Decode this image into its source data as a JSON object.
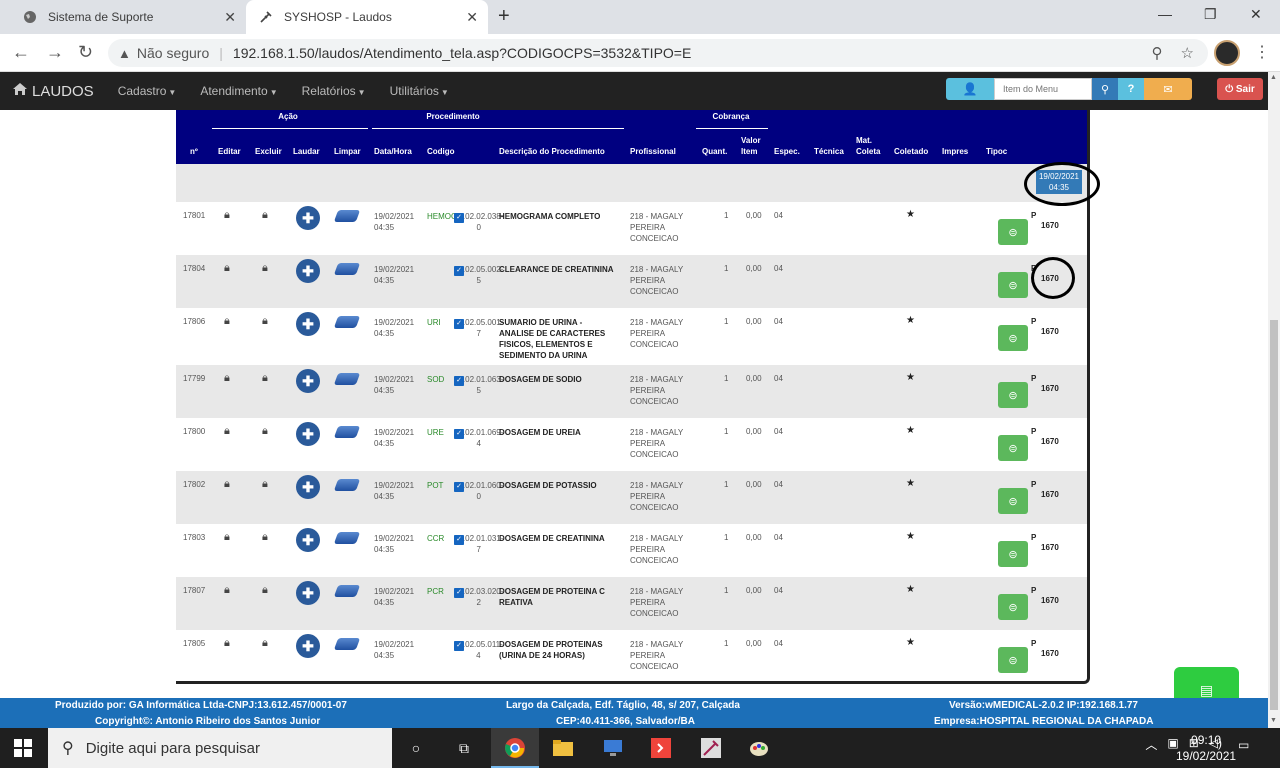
{
  "browser": {
    "tabs": [
      {
        "title": "Sistema de Suporte"
      },
      {
        "title": "SYSHOSP - Laudos"
      }
    ],
    "security_label": "Não seguro",
    "url": "192.168.1.50/laudos/Atendimento_tela.asp?CODIGOCPS=3532&TIPO=E"
  },
  "appnav": {
    "brand": "LAUDOS",
    "menus": [
      "Cadastro",
      "Atendimento",
      "Relatórios",
      "Utilitários"
    ],
    "search_placeholder": "Item do Menu",
    "logout_label": "Sair"
  },
  "table": {
    "groups": {
      "acao": "Ação",
      "procedimento": "Procedimento",
      "cobranca": "Cobrança"
    },
    "headers": {
      "num": "nº",
      "editar": "Editar",
      "excluir": "Excluir",
      "laudar": "Laudar",
      "limpar": "Limpar",
      "datahora": "Data/Hora",
      "codigo": "Codigo",
      "descricao": "Descrição do Procedimento",
      "profissional": "Profissional",
      "quant": "Quant.",
      "valor1": "Valor",
      "valor2": "Item",
      "espec": "Espec.",
      "tecnica": "Técnica",
      "mat1": "Mat.",
      "mat2": "Coleta",
      "coletado": "Coletado",
      "impres": "Impres",
      "tipoc": "Tipoc"
    },
    "group_date_line1": "19/02/2021",
    "group_date_line2": "04:35",
    "rows": [
      {
        "num": "17801",
        "date": "19/02/2021",
        "time": "04:35",
        "code": "02.02.02.038-0",
        "sigla": "HEMOG",
        "desc": "HEMOGRAMA COMPLETO",
        "prof1": "218 - MAGALY",
        "prof2": "PEREIRA",
        "prof3": "CONCEICAO",
        "qty": "1",
        "val": "0,00",
        "esp": "04",
        "star": "★",
        "tipo": "P",
        "id": "1670"
      },
      {
        "num": "17804",
        "date": "19/02/2021",
        "time": "04:35",
        "code": "02.02.05.002-5",
        "sigla": "",
        "desc": "CLEARANCE DE CREATININA",
        "prof1": "218 - MAGALY",
        "prof2": "PEREIRA",
        "prof3": "CONCEICAO",
        "qty": "1",
        "val": "0,00",
        "esp": "04",
        "star": "",
        "tipo": "P",
        "id": "1670"
      },
      {
        "num": "17806",
        "date": "19/02/2021",
        "time": "04:35",
        "code": "02.02.05.001-7",
        "sigla": "URI",
        "desc": "SUMARIO DE URINA - ANALISE DE CARACTERES FISICOS, ELEMENTOS E SEDIMENTO DA URINA",
        "prof1": "218 - MAGALY",
        "prof2": "PEREIRA",
        "prof3": "CONCEICAO",
        "qty": "1",
        "val": "0,00",
        "esp": "04",
        "star": "★",
        "tipo": "P",
        "id": "1670"
      },
      {
        "num": "17799",
        "date": "19/02/2021",
        "time": "04:35",
        "code": "02.02.01.063-5",
        "sigla": "SOD",
        "desc": "DOSAGEM DE SODIO",
        "prof1": "218 - MAGALY",
        "prof2": "PEREIRA",
        "prof3": "CONCEICAO",
        "qty": "1",
        "val": "0,00",
        "esp": "04",
        "star": "★",
        "tipo": "P",
        "id": "1670"
      },
      {
        "num": "17800",
        "date": "19/02/2021",
        "time": "04:35",
        "code": "02.02.01.069-4",
        "sigla": "URE",
        "desc": "DOSAGEM DE UREIA",
        "prof1": "218 - MAGALY",
        "prof2": "PEREIRA",
        "prof3": "CONCEICAO",
        "qty": "1",
        "val": "0,00",
        "esp": "04",
        "star": "★",
        "tipo": "P",
        "id": "1670"
      },
      {
        "num": "17802",
        "date": "19/02/2021",
        "time": "04:35",
        "code": "02.02.01.060-0",
        "sigla": "POT",
        "desc": "DOSAGEM DE POTASSIO",
        "prof1": "218 - MAGALY",
        "prof2": "PEREIRA",
        "prof3": "CONCEICAO",
        "qty": "1",
        "val": "0,00",
        "esp": "04",
        "star": "★",
        "tipo": "P",
        "id": "1670"
      },
      {
        "num": "17803",
        "date": "19/02/2021",
        "time": "04:35",
        "code": "02.02.01.031-7",
        "sigla": "CCR",
        "desc": "DOSAGEM DE CREATININA",
        "prof1": "218 - MAGALY",
        "prof2": "PEREIRA",
        "prof3": "CONCEICAO",
        "qty": "1",
        "val": "0,00",
        "esp": "04",
        "star": "★",
        "tipo": "P",
        "id": "1670"
      },
      {
        "num": "17807",
        "date": "19/02/2021",
        "time": "04:35",
        "code": "02.02.03.020-2",
        "sigla": "PCR",
        "desc": "DOSAGEM DE PROTEINA C REATIVA",
        "prof1": "218 - MAGALY",
        "prof2": "PEREIRA",
        "prof3": "CONCEICAO",
        "qty": "1",
        "val": "0,00",
        "esp": "04",
        "star": "★",
        "tipo": "P",
        "id": "1670"
      },
      {
        "num": "17805",
        "date": "19/02/2021",
        "time": "04:35",
        "code": "02.02.05.011-4",
        "sigla": "",
        "desc": "DOSAGEM DE PROTEINAS (URINA DE 24 HORAS)",
        "prof1": "218 - MAGALY",
        "prof2": "PEREIRA",
        "prof3": "CONCEICAO",
        "qty": "1",
        "val": "0,00",
        "esp": "04",
        "star": "★",
        "tipo": "P",
        "id": "1670"
      }
    ]
  },
  "footer": {
    "left1": "Produzido por: GA Informática Ltda-CNPJ:13.612.457/0001-07",
    "left2": "Copyright©: Antonio Ribeiro dos Santos Junior",
    "center1": "Largo da Calçada, Edf. Táglio, 48, s/ 207, Calçada",
    "center2": "CEP:40.411-366, Salvador/BA",
    "right1": "Versão:wMEDICAL-2.0.2 IP:192.168.1.77",
    "right2": "Empresa:HOSPITAL REGIONAL DA CHAPADA"
  },
  "taskbar": {
    "search_placeholder": "Digite aqui para pesquisar",
    "time": "09:10",
    "date": "19/02/2021"
  }
}
